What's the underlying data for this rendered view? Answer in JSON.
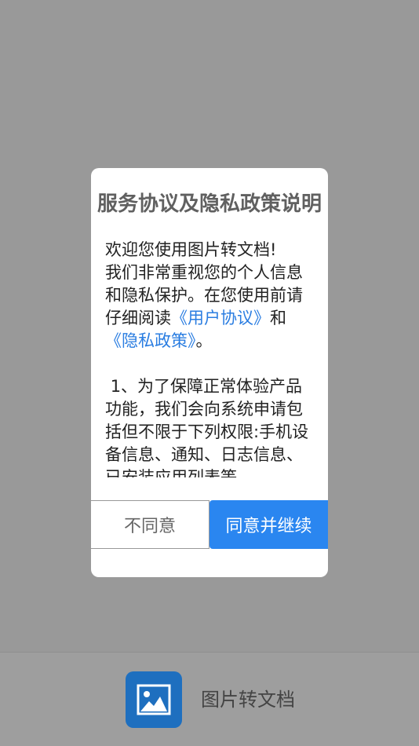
{
  "dialog": {
    "title": "服务协议及隐私政策说明",
    "intro_line1": "欢迎您使用图片转文档!",
    "intro_line2_pre": "我们非常重视您的个人信息和隐私保护。在您使用前请仔细阅读",
    "user_agreement_link": "《用户协议》",
    "and_text": "和",
    "privacy_policy_link": "《隐私政策》",
    "period": "。",
    "section1": " 1、为了保障正常体验产品功能，我们会向系统申请包括但不限于下列权限:手机设备信息、通知、日志信息、已安装应用列表等。",
    "disagree_label": "不同意",
    "agree_label": "同意并继续"
  },
  "bottom_bar": {
    "app_icon": "image-icon",
    "app_name": "图片转文档"
  },
  "colors": {
    "overlay": "#999999",
    "link": "#2a7de1",
    "primary_button": "#2a86f0",
    "app_icon_bg": "#1e6fbf"
  }
}
